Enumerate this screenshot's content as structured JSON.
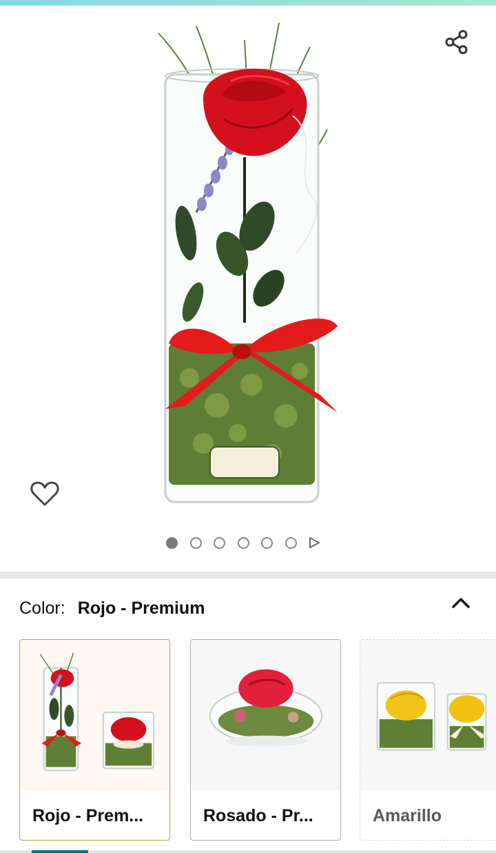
{
  "product": {
    "images_count": 6,
    "active_image_index": 0
  },
  "icons": {
    "share": "share-icon",
    "wishlist": "heart-outline-icon",
    "play": "play-triangle-icon",
    "collapse": "chevron-up-icon"
  },
  "variation": {
    "label": "Color:",
    "selected": "Rojo - Premium",
    "options": [
      {
        "label": "Rojo - Prem...",
        "selected": true
      },
      {
        "label": "Rosado - Pr...",
        "selected": false
      },
      {
        "label": "Amarillo",
        "selected": false
      }
    ]
  },
  "colors": {
    "top_accent": "#84d8e3",
    "selected_border": "#c79a3e",
    "active_dot": "#7a7a7a",
    "tab_accent": "#007185"
  }
}
